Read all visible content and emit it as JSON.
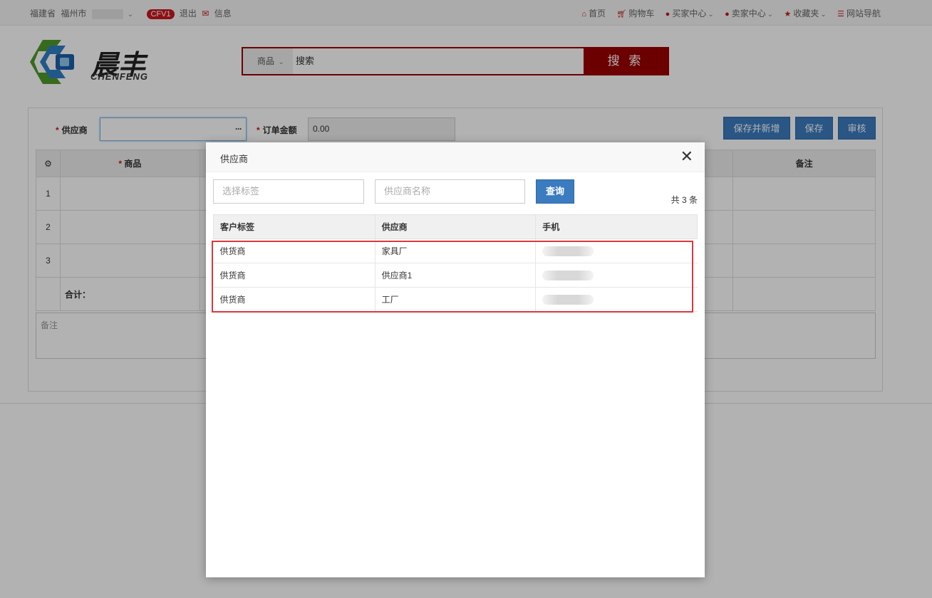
{
  "topbar": {
    "province": "福建省",
    "city": "福州市",
    "badge": "CFV1",
    "logout": "退出",
    "messages": "信息",
    "nav": {
      "home": "首页",
      "cart": "购物车",
      "buyer": "买家中心",
      "seller": "卖家中心",
      "favorites": "收藏夹",
      "sitemap": "网站导航"
    }
  },
  "logo": {
    "cn": "晨丰",
    "en": "CHENFENG"
  },
  "search": {
    "category": "商品",
    "placeholder": "搜索",
    "button": "搜 索"
  },
  "form": {
    "supplier_label": "供应商",
    "amount_label": "订单金额",
    "amount_value": "0.00",
    "buttons": {
      "save_new": "保存并新增",
      "save": "保存",
      "audit": "审核"
    },
    "grid": {
      "headers": [
        "商品",
        "备注"
      ],
      "rows": [
        "1",
        "2",
        "3"
      ],
      "total_label": "合计："
    },
    "remarks_placeholder": "备注"
  },
  "modal": {
    "title": "供应商",
    "tag_placeholder": "选择标签",
    "name_placeholder": "供应商名称",
    "query_button": "查询",
    "count": "共 3 条",
    "columns": [
      "客户标签",
      "供应商",
      "手机"
    ],
    "rows": [
      {
        "tag": "供货商",
        "name": "家具厂"
      },
      {
        "tag": "供货商",
        "name": "供应商1"
      },
      {
        "tag": "供货商",
        "name": "工厂"
      }
    ]
  },
  "colors": {
    "brand_red": "#9b0000",
    "primary_blue": "#3b7bbf",
    "highlight_red": "#e0353b"
  }
}
